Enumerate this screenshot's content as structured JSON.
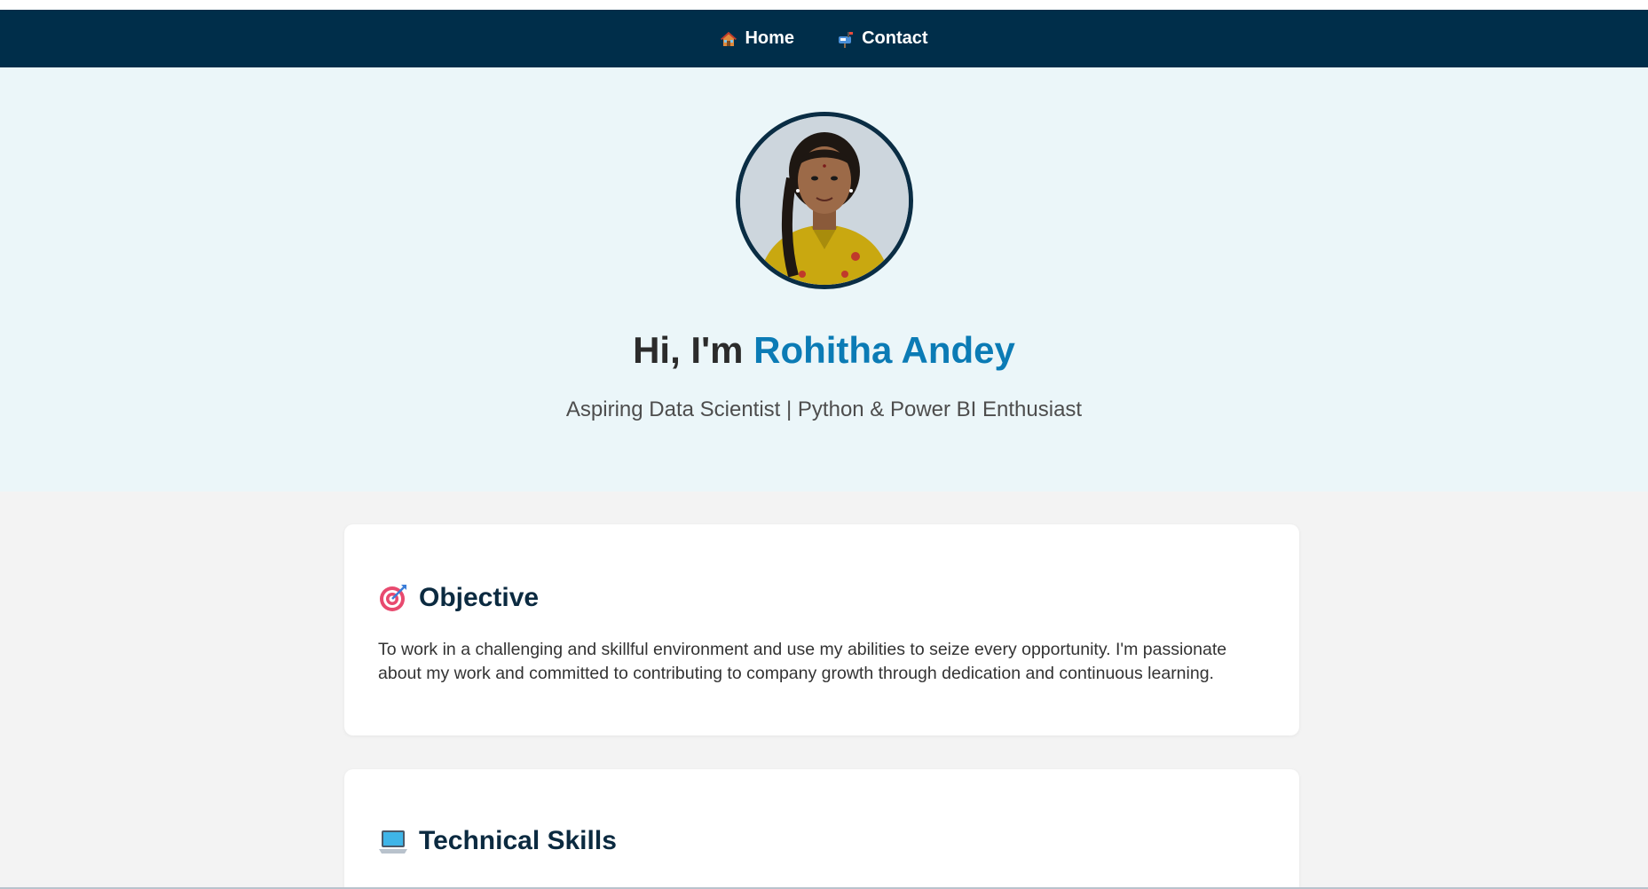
{
  "nav": {
    "items": [
      {
        "icon": "house-icon",
        "label": "Home"
      },
      {
        "icon": "mailbox-icon",
        "label": "Contact"
      }
    ]
  },
  "hero": {
    "greeting": "Hi, I'm ",
    "name": "Rohitha Andey",
    "subtitle": "Aspiring Data Scientist | Python & Power BI Enthusiast",
    "avatar_icon": "profile-photo"
  },
  "sections": {
    "objective": {
      "icon": "target-icon",
      "title": "Objective",
      "text": "To work in a challenging and skillful environment and use my abilities to seize every opportunity. I'm passionate about my work and committed to contributing to company growth through dedication and continuous learning."
    },
    "skills": {
      "icon": "laptop-icon",
      "title": "Technical Skills"
    }
  },
  "colors": {
    "nav_bg": "#002e4a",
    "hero_bg": "#ebf6f9",
    "accent": "#0b7bb5",
    "heading": "#0b2a40"
  }
}
